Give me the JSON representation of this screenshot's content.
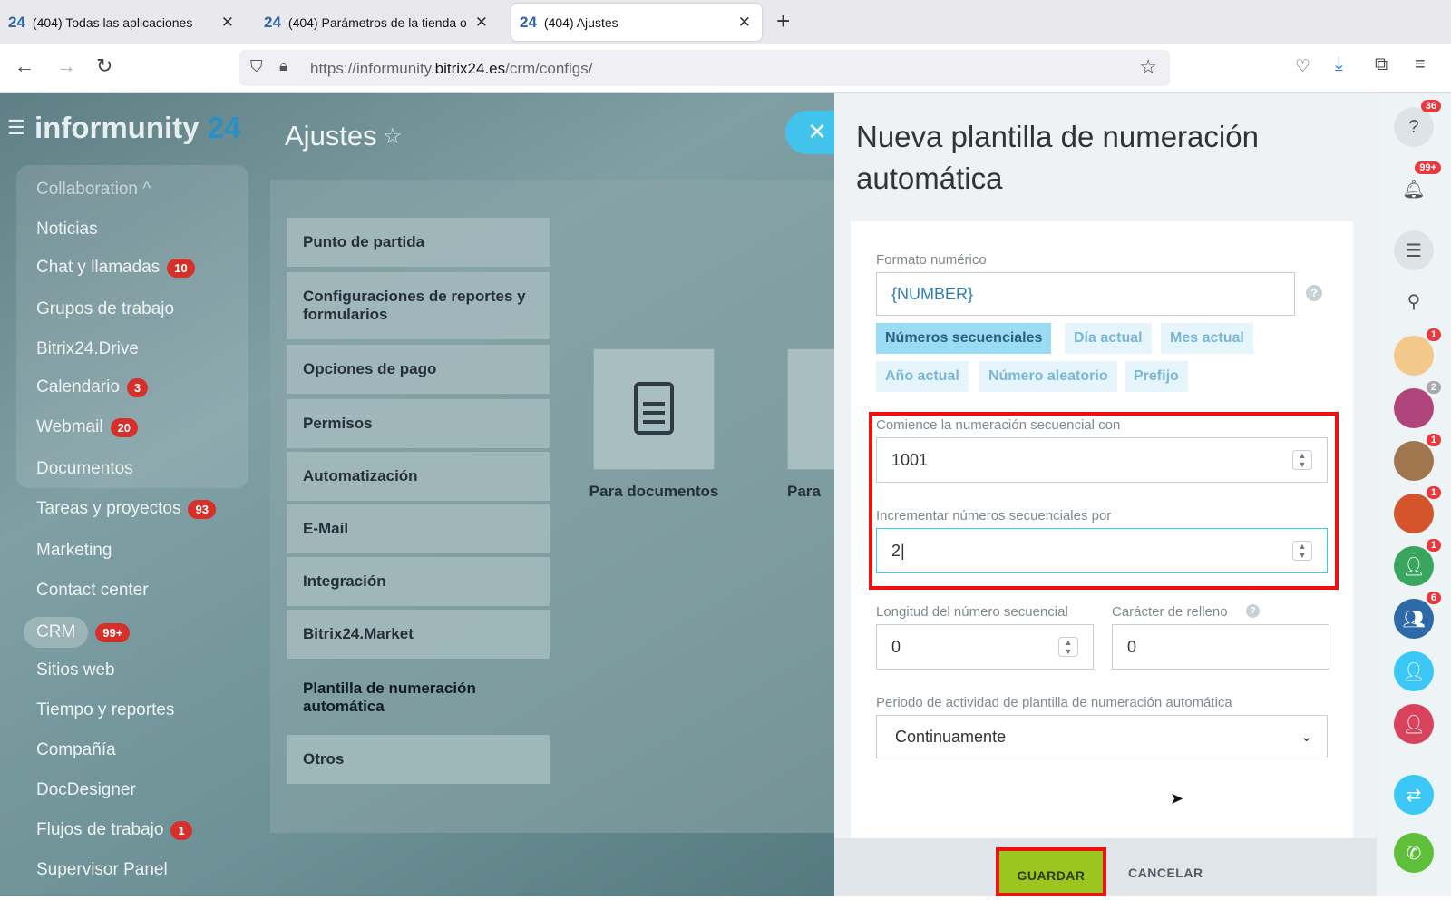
{
  "browser": {
    "tabs": [
      {
        "favicon": "24",
        "title": "(404) Todas las aplicaciones"
      },
      {
        "favicon": "24",
        "title": "(404) Parámetros de la tienda o"
      },
      {
        "favicon": "24",
        "title": "(404) Ajustes"
      }
    ],
    "url_prefix": "https://informunity.",
    "url_domain": "bitrix24.es",
    "url_path": "/crm/configs/"
  },
  "app": {
    "logo_main": "informunity",
    "logo_num": "24",
    "page_title": "Ajustes",
    "collab_label": "Collaboration ^",
    "menu": [
      {
        "label": "Noticias",
        "badge": ""
      },
      {
        "label": "Chat y llamadas",
        "badge": "10"
      },
      {
        "label": "Grupos de trabajo",
        "badge": ""
      },
      {
        "label": "Bitrix24.Drive",
        "badge": ""
      },
      {
        "label": "Calendario",
        "badge": "3"
      },
      {
        "label": "Webmail",
        "badge": "20"
      },
      {
        "label": "Documentos",
        "badge": ""
      },
      {
        "label": "Tareas y proyectos",
        "badge": "93"
      },
      {
        "label": "Marketing",
        "badge": ""
      },
      {
        "label": "Contact center",
        "badge": ""
      },
      {
        "label": "CRM",
        "badge": "99+"
      },
      {
        "label": "Sitios web",
        "badge": ""
      },
      {
        "label": "Tiempo y reportes",
        "badge": ""
      },
      {
        "label": "Compañía",
        "badge": ""
      },
      {
        "label": "DocDesigner",
        "badge": ""
      },
      {
        "label": "Flujos de trabajo",
        "badge": "1"
      },
      {
        "label": "Supervisor Panel",
        "badge": ""
      }
    ],
    "settings_nav": [
      "Punto de partida",
      "Configuraciones de reportes y formularios",
      "Opciones de pago",
      "Permisos",
      "Automatización",
      "E-Mail",
      "Integración",
      "Bitrix24.Market",
      "Plantilla de numeración automática",
      "Otros"
    ],
    "cards": [
      "Para documentos",
      "Para"
    ]
  },
  "slider": {
    "title": "Nueva plantilla de numeración automática",
    "format_label": "Formato numérico",
    "format_value": "{NUMBER}",
    "chips": [
      "Números secuenciales",
      "Día actual",
      "Mes actual",
      "Año actual",
      "Número aleatorio",
      "Prefijo"
    ],
    "start_label": "Comience la numeración secuencial con",
    "start_value": "1001",
    "increment_label": "Incrementar números secuenciales por",
    "increment_value": "2",
    "length_label": "Longitud del número secuencial",
    "length_value": "0",
    "fill_label": "Carácter de relleno",
    "fill_value": "0",
    "period_label": "Periodo de actividad de plantilla de numeración automática",
    "period_value": "Continuamente",
    "save_label": "GUARDAR",
    "cancel_label": "CANCELAR"
  },
  "rightbar": {
    "badges": [
      "36",
      "99+",
      "",
      "",
      "1",
      "2",
      "1",
      "1",
      "1",
      "6",
      "",
      "",
      ""
    ]
  }
}
